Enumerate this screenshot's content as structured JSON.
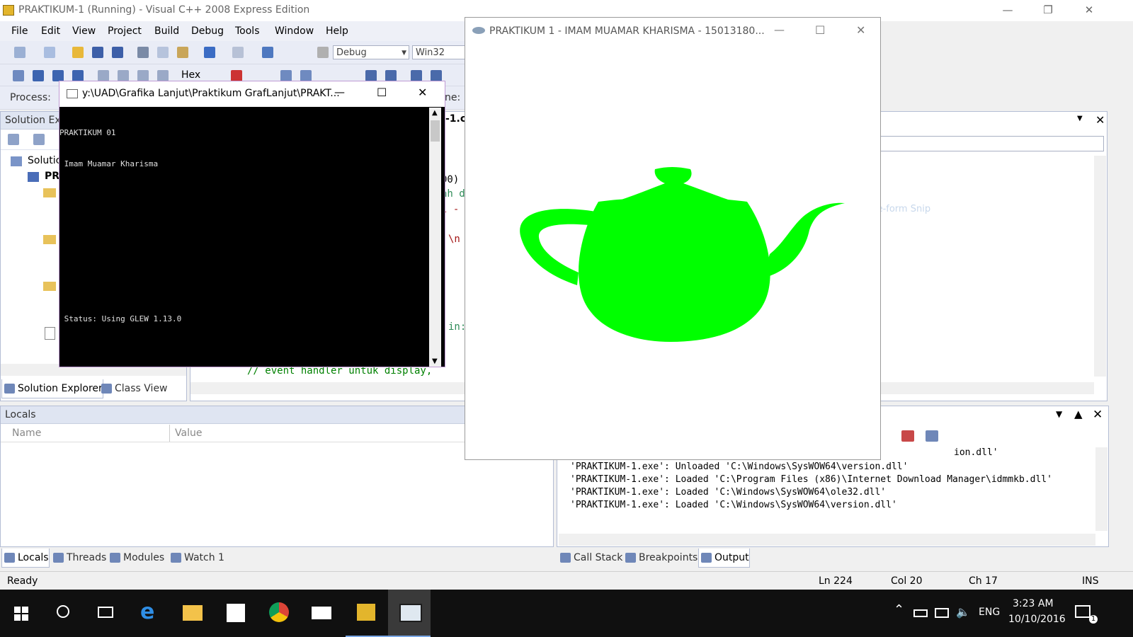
{
  "ide": {
    "title": "PRAKTIKUM-1 (Running) - Visual C++ 2008 Express Edition",
    "menu": [
      "File",
      "Edit",
      "View",
      "Project",
      "Build",
      "Debug",
      "Tools",
      "Window",
      "Help"
    ],
    "config_combo": "Debug",
    "platform_combo": "Win32",
    "hex_label": "Hex",
    "process_label": "Process:",
    "thread_label_fragment": "ne:"
  },
  "solution_explorer": {
    "header": "Solution Exp",
    "tree": [
      "Solutic",
      "PRA"
    ],
    "tabs": [
      "Solution Explorer",
      "Class View"
    ]
  },
  "editor": {
    "file_tab_fragment": "-1.cp",
    "code_fragments": [
      "00)",
      "ah d",
      "l -",
      "\\n",
      "in:"
    ],
    "bottom_line": "// event handler untuk display,",
    "snip_hint": "Free-form Snip"
  },
  "locals": {
    "header": "Locals",
    "columns": [
      "Name",
      "Value"
    ]
  },
  "output": {
    "lines": [
      "ion.dll'",
      "'PRAKTIKUM-1.exe': Unloaded 'C:\\Windows\\SysWOW64\\version.dll'",
      "'PRAKTIKUM-1.exe': Loaded 'C:\\Program Files (x86)\\Internet Download Manager\\idmmkb.dll'",
      "'PRAKTIKUM-1.exe': Loaded 'C:\\Windows\\SysWOW64\\ole32.dll'",
      "'PRAKTIKUM-1.exe': Loaded 'C:\\Windows\\SysWOW64\\version.dll'"
    ]
  },
  "bottom_tabs_left": [
    "Locals",
    "Threads",
    "Modules",
    "Watch 1"
  ],
  "bottom_tabs_right": [
    "Call Stack",
    "Breakpoints",
    "Output"
  ],
  "status": {
    "ready": "Ready",
    "ln": "Ln 224",
    "col": "Col 20",
    "ch": "Ch 17",
    "mode": "INS"
  },
  "console": {
    "title": "y:\\UAD\\Grafika Lanjut\\Praktikum GrafLanjut\\PRAKT...",
    "lines": [
      "PRAKTIKUM 01",
      " Imam Muamar Kharisma",
      "",
      "",
      "",
      "",
      " Status: Using GLEW 1.13.0"
    ]
  },
  "glwindow": {
    "title": "PRAKTIKUM 1 - IMAM MUAMAR KHARISMA - 15013180...",
    "teapot_color": "#00ff00"
  },
  "taskbar": {
    "language": "ENG",
    "time": "3:23 AM",
    "date": "10/10/2016",
    "notifications": "1"
  }
}
